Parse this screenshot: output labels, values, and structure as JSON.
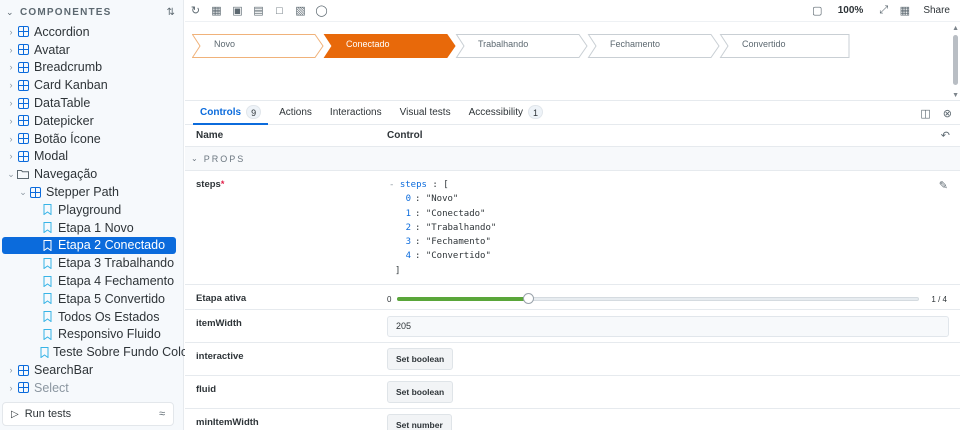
{
  "sidebar": {
    "title": "COMPONENTES",
    "items": [
      {
        "label": "Accordion"
      },
      {
        "label": "Avatar"
      },
      {
        "label": "Breadcrumb"
      },
      {
        "label": "Card Kanban"
      },
      {
        "label": "DataTable"
      },
      {
        "label": "Datepicker"
      },
      {
        "label": "Botão Ícone"
      },
      {
        "label": "Modal"
      },
      {
        "label": "Navegação"
      },
      {
        "label": "Stepper Path"
      },
      {
        "label": "Playground"
      },
      {
        "label": "Etapa 1 Novo"
      },
      {
        "label": "Etapa 2 Conectado"
      },
      {
        "label": "Etapa 3 Trabalhando"
      },
      {
        "label": "Etapa 4 Fechamento"
      },
      {
        "label": "Etapa 5 Convertido"
      },
      {
        "label": "Todos Os Estados"
      },
      {
        "label": "Responsivo Fluido"
      },
      {
        "label": "Teste Sobre Fundo Colorido"
      },
      {
        "label": "SearchBar"
      },
      {
        "label": "Select"
      }
    ],
    "run_tests": "Run tests"
  },
  "toolbar": {
    "zoom": "100%",
    "share": "Share"
  },
  "preview": {
    "steps": [
      {
        "label": "Novo",
        "state": "default"
      },
      {
        "label": "Conectado",
        "state": "active"
      },
      {
        "label": "Trabalhando",
        "state": "default"
      },
      {
        "label": "Fechamento",
        "state": "default"
      },
      {
        "label": "Convertido",
        "state": "default"
      }
    ],
    "colors": {
      "active": "#e8690a",
      "active_border": "#e8690a",
      "default_border": "#c9cfd4",
      "first_border": "#f0b27a"
    }
  },
  "addons": {
    "tabs": [
      {
        "label": "Controls",
        "badge": "9"
      },
      {
        "label": "Actions",
        "badge": ""
      },
      {
        "label": "Interactions",
        "badge": ""
      },
      {
        "label": "Visual tests",
        "badge": ""
      },
      {
        "label": "Accessibility",
        "badge": "1"
      }
    ],
    "header": {
      "name": "Name",
      "control": "Control"
    },
    "section": "PROPS",
    "steps_prop": {
      "name": "steps",
      "required_mark": "*",
      "key": "steps",
      "open": "[",
      "close": "]",
      "items": [
        {
          "index": "0",
          "value": "\"Novo\""
        },
        {
          "index": "1",
          "value": "\"Conectado\""
        },
        {
          "index": "2",
          "value": "\"Trabalhando\""
        },
        {
          "index": "3",
          "value": "\"Fechamento\""
        },
        {
          "index": "4",
          "value": "\"Convertido\""
        }
      ]
    },
    "etapa_ativa": {
      "name": "Etapa ativa",
      "min": "0",
      "max_label": "1 / 4",
      "value": 1,
      "max": 4
    },
    "item_width": {
      "name": "itemWidth",
      "value": "205"
    },
    "interactive": {
      "name": "interactive",
      "button": "Set boolean"
    },
    "fluid": {
      "name": "fluid",
      "button": "Set boolean"
    },
    "min_item_width": {
      "name": "minItemWidth",
      "button": "Set number"
    }
  }
}
